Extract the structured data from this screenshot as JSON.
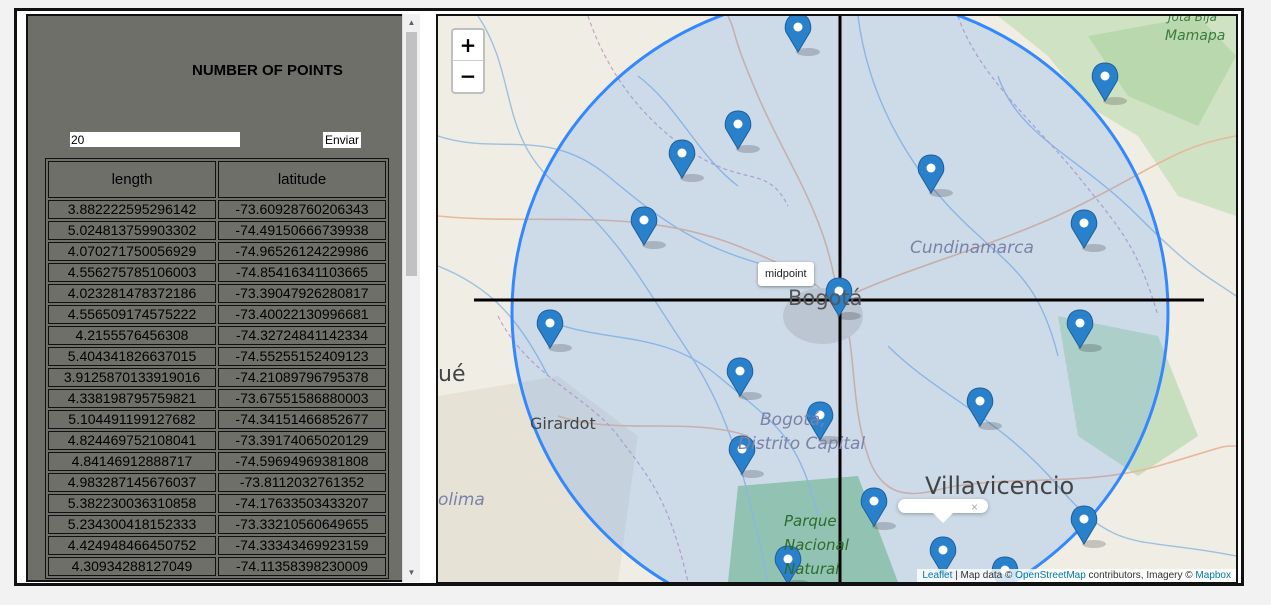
{
  "panel": {
    "title": "NUMBER OF POINTS",
    "input_value": "20",
    "send_label": "Enviar"
  },
  "table": {
    "headers": [
      "length",
      "latitude"
    ],
    "rows": [
      [
        "3.882222595296142",
        "-73.60928760206343"
      ],
      [
        "5.024813759903302",
        "-74.49150666739938"
      ],
      [
        "4.070271750056929",
        "-74.96526124229986"
      ],
      [
        "4.556275785106003",
        "-74.85416341103665"
      ],
      [
        "4.023281478372186",
        "-73.39047926280817"
      ],
      [
        "4.556509174575222",
        "-73.40022130996681"
      ],
      [
        "4.2155576456308",
        "-74.32724841142334"
      ],
      [
        "5.404341826637015",
        "-74.55255152409123"
      ],
      [
        "3.9125870133919016",
        "-74.21089796795378"
      ],
      [
        "4.338198795759821",
        "-73.67551586880003"
      ],
      [
        "5.104491199127682",
        "-74.34151466852677"
      ],
      [
        "4.824469752108041",
        "-73.39174065020129"
      ],
      [
        "4.84146912888717",
        "-74.59694969381808"
      ],
      [
        "4.983287145676037",
        "-73.8112032761352"
      ],
      [
        "5.382230036310858",
        "-74.17633503433207"
      ],
      [
        "5.234300418152333",
        "-73.33210560649655"
      ],
      [
        "4.424948466450752",
        "-74.33343469923159"
      ],
      [
        "4.30934288127049",
        "-74.11358398230009"
      ]
    ]
  },
  "scrollbar": {
    "up_icon": "▲",
    "down_icon": "▼"
  },
  "map": {
    "zoom_in": "+",
    "zoom_out": "−",
    "tooltip": "midpoint",
    "popup_close": "×",
    "labels": {
      "bogota": "Bogotá",
      "cundinamarca": "Cundinamarca",
      "girardot": "Girardot",
      "bogota_dc_1": "Bogotá,",
      "bogota_dc_2": "Distrito Capital",
      "villavicencio": "Villavicencio",
      "parque_1": "Parque",
      "parque_2": "Nacional",
      "parque_3": "Natural",
      "ibague_fragment": "ué",
      "tolima_fragment": "olima",
      "mamapa": "Mamapa",
      "jota": "Jota Bija"
    },
    "attribution": {
      "leaflet": "Leaflet",
      "sep1": " | Map data © ",
      "osm": "OpenStreetMap",
      "sep2": " contributors, Imagery © ",
      "mapbox": "Mapbox"
    },
    "colors": {
      "circle": "#3388ff",
      "marker": "#2a81cb",
      "water": "#9ec0e0"
    }
  }
}
